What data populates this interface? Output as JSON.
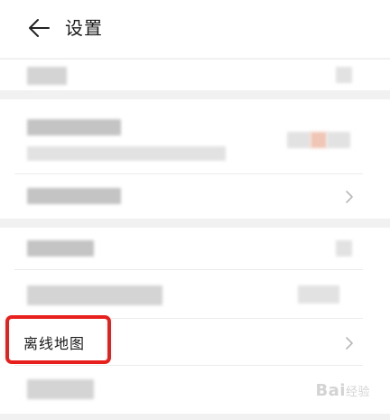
{
  "header": {
    "back_icon": "arrow-left-icon",
    "title": "设置"
  },
  "rows": {
    "offline_map": {
      "label": "离线地图",
      "icon": "chevron-right-icon"
    }
  },
  "watermark": {
    "text": "Bai",
    "suffix": "经验"
  },
  "colors": {
    "highlight": "#e8201d",
    "background": "#f1f1f1"
  }
}
